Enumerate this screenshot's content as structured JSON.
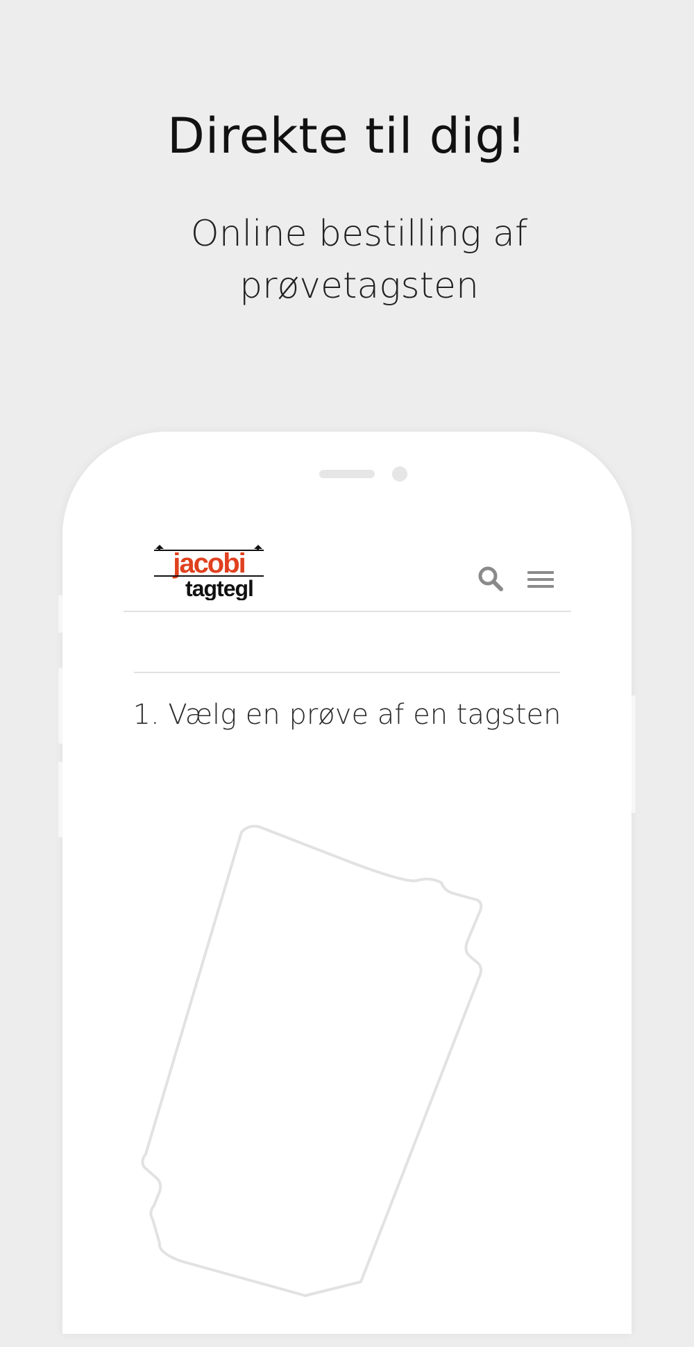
{
  "headline": "Direkte til dig!",
  "subline": "Online bestilling af prøvetagsten",
  "app": {
    "logo": {
      "name": "jacobi tagtegl",
      "top": "jacobi",
      "bottom": "tagtegl"
    },
    "icons": {
      "search": "search-icon",
      "menu": "hamburger-menu-icon"
    },
    "step_title": "1. Vælg en prøve af en tagsten"
  },
  "colors": {
    "brand_red": "#e0401e",
    "background": "#ededed",
    "icon_gray": "#8a8a8a"
  }
}
